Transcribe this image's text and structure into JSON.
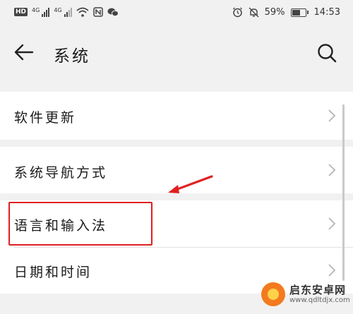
{
  "status_bar": {
    "hd": "HD",
    "network1": "4G",
    "network2": "4G",
    "battery_percent": "59%",
    "time": "14:53",
    "battery_level": 0.59,
    "icons": [
      "hd-badge",
      "signal-icon",
      "signal-icon",
      "wifi-icon",
      "nfc-icon",
      "wechat-icon",
      "alarm-icon",
      "mute-icon",
      "battery-icon"
    ]
  },
  "header": {
    "title": "系统",
    "back_icon": "back-arrow-icon",
    "search_icon": "search-icon"
  },
  "menu": {
    "items": [
      {
        "label": "软件更新"
      },
      {
        "label": "系统导航方式"
      },
      {
        "label": "语言和输入法"
      },
      {
        "label": "日期和时间"
      }
    ]
  },
  "annotation": {
    "highlight_color": "#e02020",
    "highlighted_item": "语言和输入法"
  },
  "watermark": {
    "name": "启东安卓网",
    "url": "www.qdltdjx.com"
  },
  "colors": {
    "background": "#f1f1f1",
    "card": "#ffffff",
    "text": "#1a1a1a",
    "annotation": "#e02020"
  }
}
